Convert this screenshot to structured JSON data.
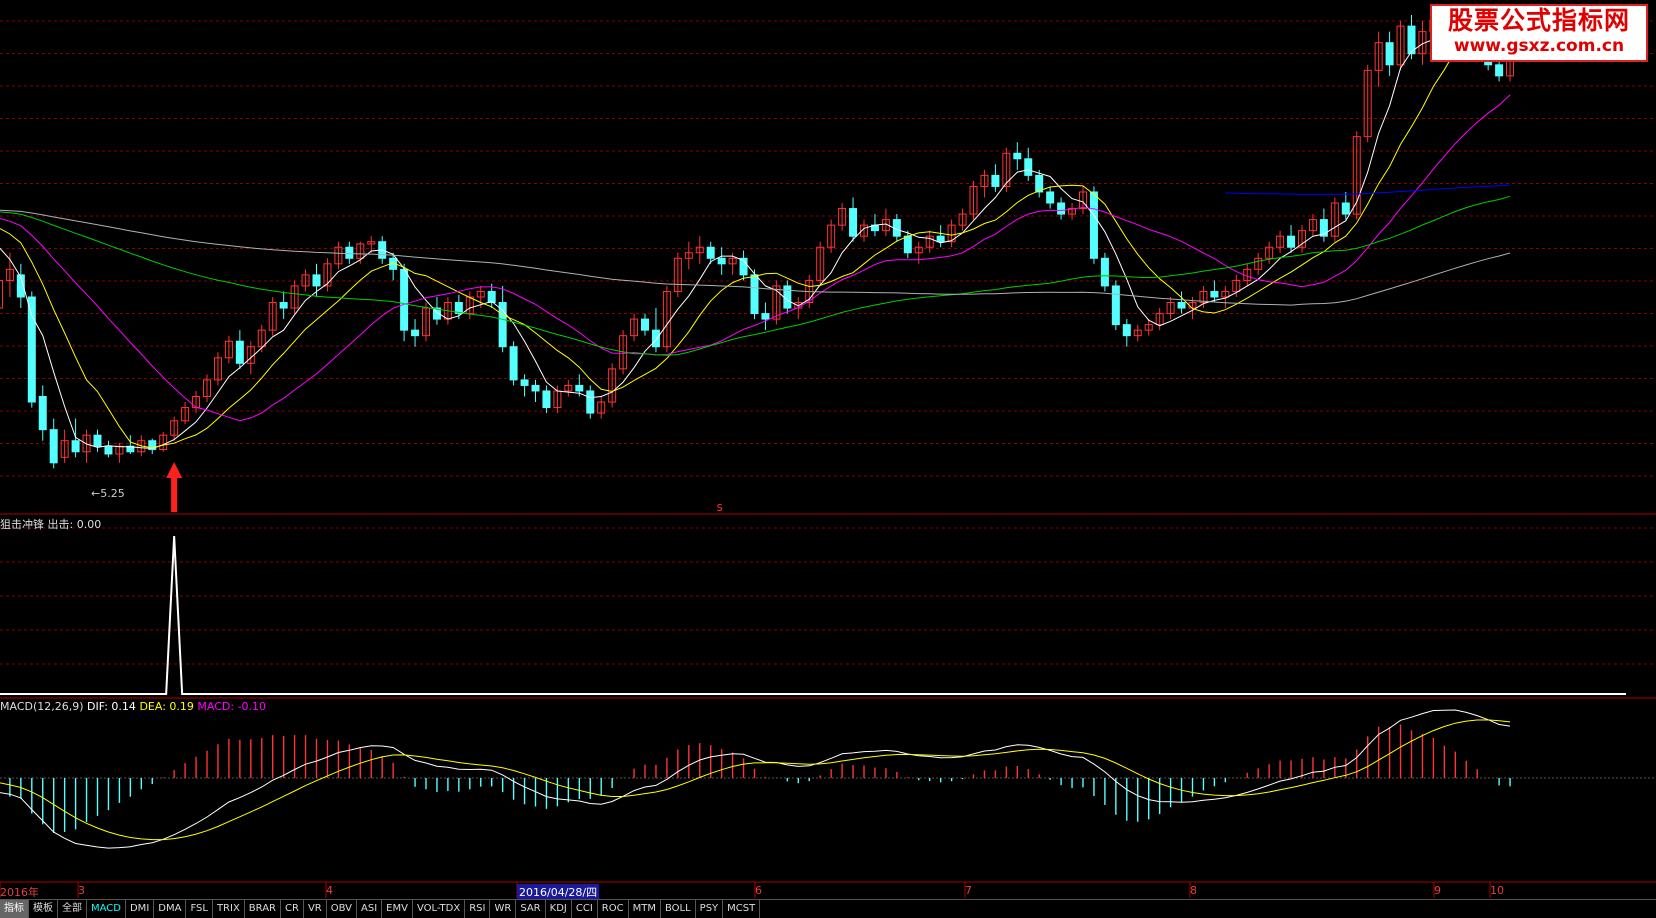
{
  "watermark": {
    "title": "股票公式指标网",
    "url": "www.gsxz.com.cn"
  },
  "colors": {
    "up": "#ff3333",
    "down": "#54ffff",
    "ma5": "#ffffff",
    "ma10": "#ffff00",
    "ma20": "#ff00ff",
    "ma60": "#00cc00",
    "ma120": "#b0b0b0",
    "ma250": "#0000ff",
    "grid": "#8b0000",
    "panel_border": "#b00000",
    "background": "#000000"
  },
  "main_panel": {
    "low_marker_label": "5.25",
    "mark_s": "s",
    "signal_arrow_icon": "red-up-arrow-icon"
  },
  "indicator_panel": {
    "title": "狙击冲锋 出击: 0.00"
  },
  "macd_panel": {
    "name": "MACD(12,26,9)",
    "dif": "DIF: 0.14",
    "dea": "DEA: 0.19",
    "macd": "MACD: -0.10"
  },
  "date_axis": {
    "labels": [
      "2016年",
      "3",
      "4",
      "2016/04/28/四",
      "6",
      "7",
      "8",
      "9",
      "10"
    ]
  },
  "tabs": [
    "指标",
    "模板",
    "全部",
    "MACD",
    "DMI",
    "DMA",
    "FSL",
    "TRIX",
    "BRAR",
    "CR",
    "VR",
    "OBV",
    "ASI",
    "EMV",
    "VOL-TDX",
    "RSI",
    "WR",
    "SAR",
    "KDJ",
    "CCI",
    "ROC",
    "MTM",
    "BOLL",
    "PSY",
    "MCST"
  ],
  "active_tab": "MACD",
  "chart_data": [
    {
      "type": "candlestick",
      "title": "",
      "series": [
        {
          "name": "price",
          "ohlc": [
            [
              6.6,
              6.9,
              6.35,
              6.5
            ],
            [
              6.7,
              7.1,
              6.6,
              6.95
            ],
            [
              6.95,
              7.2,
              6.8,
              7.05
            ],
            [
              7.0,
              7.1,
              6.7,
              6.8
            ],
            [
              6.8,
              6.85,
              5.8,
              5.85
            ],
            [
              5.9,
              6.0,
              5.5,
              5.6
            ],
            [
              5.6,
              5.7,
              5.25,
              5.3
            ],
            [
              5.35,
              5.6,
              5.3,
              5.5
            ],
            [
              5.5,
              5.7,
              5.35,
              5.4
            ],
            [
              5.4,
              5.6,
              5.3,
              5.55
            ],
            [
              5.55,
              5.6,
              5.4,
              5.45
            ],
            [
              5.45,
              5.5,
              5.35,
              5.38
            ],
            [
              5.38,
              5.48,
              5.3,
              5.45
            ],
            [
              5.45,
              5.55,
              5.38,
              5.4
            ],
            [
              5.4,
              5.55,
              5.36,
              5.5
            ],
            [
              5.5,
              5.52,
              5.38,
              5.42
            ],
            [
              5.42,
              5.58,
              5.4,
              5.55
            ],
            [
              5.55,
              5.72,
              5.5,
              5.68
            ],
            [
              5.68,
              5.85,
              5.65,
              5.8
            ],
            [
              5.8,
              5.95,
              5.75,
              5.9
            ],
            [
              5.9,
              6.1,
              5.85,
              6.05
            ],
            [
              6.05,
              6.3,
              6.0,
              6.25
            ],
            [
              6.25,
              6.45,
              6.2,
              6.4
            ],
            [
              6.4,
              6.5,
              6.15,
              6.2
            ],
            [
              6.2,
              6.4,
              6.1,
              6.35
            ],
            [
              6.35,
              6.55,
              6.3,
              6.5
            ],
            [
              6.5,
              6.8,
              6.45,
              6.75
            ],
            [
              6.75,
              6.85,
              6.6,
              6.7
            ],
            [
              6.7,
              6.95,
              6.65,
              6.9
            ],
            [
              6.9,
              7.05,
              6.85,
              7.0
            ],
            [
              7.0,
              7.1,
              6.8,
              6.9
            ],
            [
              6.9,
              7.15,
              6.85,
              7.1
            ],
            [
              7.1,
              7.3,
              7.05,
              7.25
            ],
            [
              7.25,
              7.3,
              7.1,
              7.15
            ],
            [
              7.15,
              7.3,
              7.1,
              7.28
            ],
            [
              7.28,
              7.35,
              7.2,
              7.3
            ],
            [
              7.3,
              7.35,
              7.1,
              7.15
            ],
            [
              7.15,
              7.2,
              6.95,
              7.05
            ],
            [
              7.05,
              7.1,
              6.4,
              6.5
            ],
            [
              6.5,
              6.6,
              6.35,
              6.45
            ],
            [
              6.45,
              6.75,
              6.4,
              6.7
            ],
            [
              6.7,
              6.8,
              6.55,
              6.6
            ],
            [
              6.6,
              6.8,
              6.55,
              6.75
            ],
            [
              6.75,
              6.82,
              6.6,
              6.65
            ],
            [
              6.65,
              6.85,
              6.6,
              6.8
            ],
            [
              6.8,
              6.9,
              6.7,
              6.85
            ],
            [
              6.85,
              6.92,
              6.7,
              6.75
            ],
            [
              6.75,
              6.9,
              6.3,
              6.35
            ],
            [
              6.35,
              6.4,
              6.0,
              6.05
            ],
            [
              6.05,
              6.1,
              5.9,
              6.0
            ],
            [
              6.0,
              6.05,
              5.85,
              5.95
            ],
            [
              5.95,
              6.0,
              5.75,
              5.8
            ],
            [
              5.8,
              6.0,
              5.75,
              5.95
            ],
            [
              5.95,
              6.05,
              5.9,
              6.0
            ],
            [
              6.0,
              6.1,
              5.9,
              5.95
            ],
            [
              5.95,
              6.0,
              5.7,
              5.75
            ],
            [
              5.75,
              5.9,
              5.7,
              5.85
            ],
            [
              5.85,
              6.2,
              5.8,
              6.15
            ],
            [
              6.15,
              6.5,
              6.1,
              6.45
            ],
            [
              6.45,
              6.65,
              6.4,
              6.6
            ],
            [
              6.6,
              6.65,
              6.45,
              6.5
            ],
            [
              6.5,
              6.7,
              6.3,
              6.35
            ],
            [
              6.35,
              6.9,
              6.3,
              6.85
            ],
            [
              6.85,
              7.2,
              6.8,
              7.15
            ],
            [
              7.15,
              7.3,
              7.05,
              7.2
            ],
            [
              7.2,
              7.35,
              7.1,
              7.25
            ],
            [
              7.25,
              7.3,
              7.1,
              7.15
            ],
            [
              7.15,
              7.25,
              7.0,
              7.1
            ],
            [
              7.1,
              7.2,
              7.0,
              7.15
            ],
            [
              7.15,
              7.22,
              6.95,
              7.0
            ],
            [
              7.0,
              7.05,
              6.6,
              6.65
            ],
            [
              6.65,
              6.75,
              6.5,
              6.6
            ],
            [
              6.6,
              6.95,
              6.55,
              6.9
            ],
            [
              6.9,
              6.95,
              6.65,
              6.7
            ],
            [
              6.7,
              6.8,
              6.6,
              6.75
            ],
            [
              6.75,
              7.0,
              6.7,
              6.95
            ],
            [
              6.95,
              7.3,
              6.9,
              7.25
            ],
            [
              7.25,
              7.5,
              7.2,
              7.45
            ],
            [
              7.45,
              7.65,
              7.4,
              7.6
            ],
            [
              7.6,
              7.7,
              7.3,
              7.35
            ],
            [
              7.35,
              7.5,
              7.3,
              7.45
            ],
            [
              7.45,
              7.55,
              7.35,
              7.4
            ],
            [
              7.4,
              7.6,
              7.35,
              7.5
            ],
            [
              7.5,
              7.55,
              7.3,
              7.35
            ],
            [
              7.35,
              7.4,
              7.15,
              7.2
            ],
            [
              7.2,
              7.3,
              7.1,
              7.25
            ],
            [
              7.25,
              7.4,
              7.2,
              7.35
            ],
            [
              7.35,
              7.45,
              7.25,
              7.3
            ],
            [
              7.3,
              7.5,
              7.25,
              7.45
            ],
            [
              7.45,
              7.6,
              7.4,
              7.55
            ],
            [
              7.55,
              7.85,
              7.5,
              7.8
            ],
            [
              7.8,
              7.95,
              7.7,
              7.9
            ],
            [
              7.9,
              8.0,
              7.75,
              7.8
            ],
            [
              7.8,
              8.15,
              7.75,
              8.1
            ],
            [
              8.1,
              8.2,
              7.95,
              8.05
            ],
            [
              8.05,
              8.15,
              7.85,
              7.9
            ],
            [
              7.9,
              7.95,
              7.7,
              7.75
            ],
            [
              7.75,
              7.8,
              7.6,
              7.65
            ],
            [
              7.65,
              7.7,
              7.5,
              7.55
            ],
            [
              7.55,
              7.65,
              7.5,
              7.6
            ],
            [
              7.6,
              7.8,
              7.55,
              7.75
            ],
            [
              7.75,
              7.8,
              7.1,
              7.15
            ],
            [
              7.15,
              7.2,
              6.85,
              6.9
            ],
            [
              6.9,
              6.95,
              6.5,
              6.55
            ],
            [
              6.55,
              6.6,
              6.35,
              6.45
            ],
            [
              6.45,
              6.55,
              6.4,
              6.5
            ],
            [
              6.5,
              6.6,
              6.45,
              6.55
            ],
            [
              6.55,
              6.7,
              6.5,
              6.65
            ],
            [
              6.65,
              6.8,
              6.6,
              6.75
            ],
            [
              6.75,
              6.85,
              6.65,
              6.7
            ],
            [
              6.7,
              6.8,
              6.6,
              6.75
            ],
            [
              6.75,
              6.9,
              6.7,
              6.85
            ],
            [
              6.85,
              6.95,
              6.75,
              6.8
            ],
            [
              6.8,
              6.9,
              6.7,
              6.85
            ],
            [
              6.85,
              7.0,
              6.8,
              6.95
            ],
            [
              6.95,
              7.1,
              6.9,
              7.05
            ],
            [
              7.05,
              7.2,
              7.0,
              7.15
            ],
            [
              7.15,
              7.3,
              7.1,
              7.25
            ],
            [
              7.25,
              7.4,
              7.2,
              7.35
            ],
            [
              7.35,
              7.45,
              7.2,
              7.25
            ],
            [
              7.25,
              7.45,
              7.2,
              7.4
            ],
            [
              7.4,
              7.55,
              7.35,
              7.5
            ],
            [
              7.5,
              7.6,
              7.3,
              7.35
            ],
            [
              7.35,
              7.7,
              7.3,
              7.65
            ],
            [
              7.65,
              7.75,
              7.5,
              7.55
            ],
            [
              7.55,
              8.3,
              7.5,
              8.25
            ],
            [
              8.25,
              8.9,
              8.2,
              8.85
            ],
            [
              8.85,
              9.2,
              8.7,
              9.1
            ],
            [
              9.1,
              9.2,
              8.8,
              8.9
            ],
            [
              8.9,
              9.3,
              8.85,
              9.25
            ],
            [
              9.25,
              9.35,
              8.95,
              9.0
            ],
            [
              9.0,
              9.3,
              8.9,
              9.2
            ],
            [
              9.2,
              9.35,
              9.05,
              9.3
            ],
            [
              9.3,
              9.4,
              9.1,
              9.15
            ],
            [
              9.15,
              9.3,
              9.05,
              9.25
            ],
            [
              9.25,
              9.3,
              9.0,
              9.05
            ],
            [
              9.05,
              9.15,
              8.95,
              9.0
            ],
            [
              9.0,
              9.1,
              8.85,
              8.9
            ],
            [
              8.9,
              9.0,
              8.75,
              8.8
            ],
            [
              8.8,
              9.15,
              8.75,
              9.1
            ]
          ]
        },
        {
          "name": "MA5",
          "color": "#ffffff"
        },
        {
          "name": "MA10",
          "color": "#ffff00"
        },
        {
          "name": "MA20",
          "color": "#ff00ff"
        },
        {
          "name": "MA60",
          "color": "#00cc00"
        },
        {
          "name": "MA120",
          "color": "#b0b0b0"
        },
        {
          "name": "MA250",
          "color": "#0000ff"
        }
      ],
      "ylim": [
        5.0,
        9.45
      ],
      "grid": true,
      "signal_index": 17
    },
    {
      "type": "line",
      "title": "狙击冲锋 出击: 0.00",
      "series": [
        {
          "name": "出击",
          "color": "#ffffff",
          "spike_index": 17,
          "spike_value": 1,
          "baseline": 0
        }
      ],
      "ylim": [
        0,
        1
      ]
    },
    {
      "type": "bar",
      "title": "MACD(12,26,9)",
      "series": [
        {
          "name": "DIF",
          "color": "#ffffff",
          "last": 0.14
        },
        {
          "name": "DEA",
          "color": "#ffff00",
          "last": 0.19
        },
        {
          "name": "MACD",
          "color": "#ff00ff",
          "last": -0.1
        }
      ],
      "grid": false
    }
  ]
}
